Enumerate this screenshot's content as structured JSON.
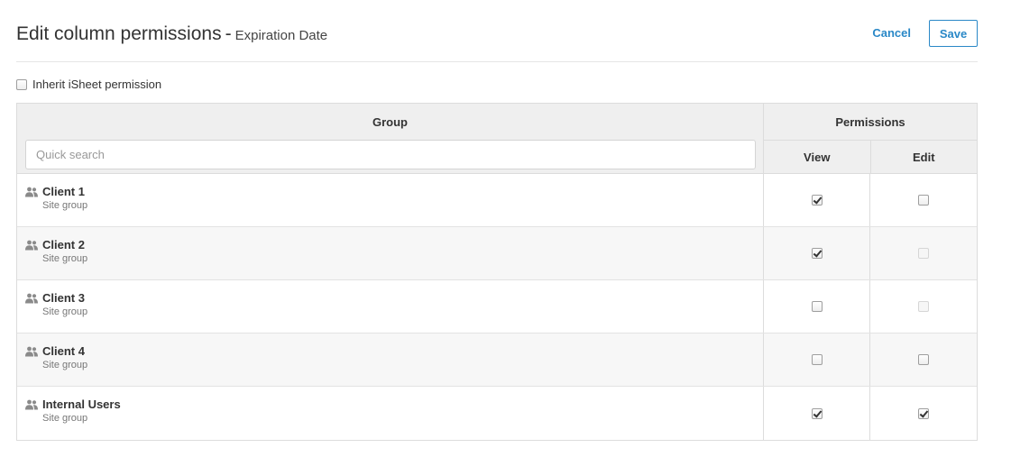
{
  "header": {
    "title": "Edit column permissions",
    "separator": "-",
    "column_name": "Expiration Date",
    "cancel_label": "Cancel",
    "save_label": "Save"
  },
  "inherit": {
    "label": "Inherit iSheet permission",
    "checked": false
  },
  "table": {
    "group_header": "Group",
    "permissions_header": "Permissions",
    "view_header": "View",
    "edit_header": "Edit",
    "search_placeholder": "Quick search",
    "search_value": "",
    "rows": [
      {
        "name": "Client 1",
        "type": "Site group",
        "view": true,
        "edit": false,
        "edit_disabled": false
      },
      {
        "name": "Client 2",
        "type": "Site group",
        "view": true,
        "edit": false,
        "edit_disabled": true
      },
      {
        "name": "Client 3",
        "type": "Site group",
        "view": false,
        "edit": false,
        "edit_disabled": true
      },
      {
        "name": "Client 4",
        "type": "Site group",
        "view": false,
        "edit": false,
        "edit_disabled": false
      },
      {
        "name": "Internal Users",
        "type": "Site group",
        "view": true,
        "edit": true,
        "edit_disabled": false
      }
    ]
  },
  "icons": {
    "group": "users-icon"
  },
  "colors": {
    "accent": "#2a88c7",
    "header_bg": "#efefef",
    "border": "#dcdcdc"
  }
}
